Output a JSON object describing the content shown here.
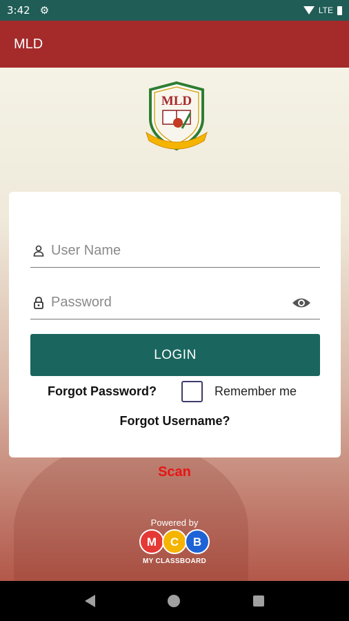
{
  "status_bar": {
    "time": "3:42",
    "network_label": "LTE"
  },
  "app_bar": {
    "title": "MLD"
  },
  "logo": {
    "text": "MLD"
  },
  "login_form": {
    "username_placeholder": "User Name",
    "password_placeholder": "Password",
    "login_label": "LOGIN",
    "forgot_password_label": "Forgot Password?",
    "remember_me_label": "Remember me",
    "remember_me_checked": false,
    "forgot_username_label": "Forgot Username?"
  },
  "scan_label": "Scan",
  "footer": {
    "powered_by": "Powered by",
    "badge_letters": [
      "M",
      "C",
      "B"
    ],
    "brand_name": "MY CLASSBOARD"
  },
  "colors": {
    "status_bar": "#1f5d56",
    "app_bar": "#a52a2a",
    "login_button": "#1a665e",
    "scan": "#e81515",
    "badge_m": "#e53935",
    "badge_c": "#f5b400",
    "badge_b": "#1e63d6"
  },
  "icons": [
    "settings-gear-icon",
    "wifi-icon",
    "battery-icon",
    "person-icon",
    "lock-icon",
    "eye-icon",
    "back-icon",
    "home-icon",
    "recents-icon"
  ]
}
